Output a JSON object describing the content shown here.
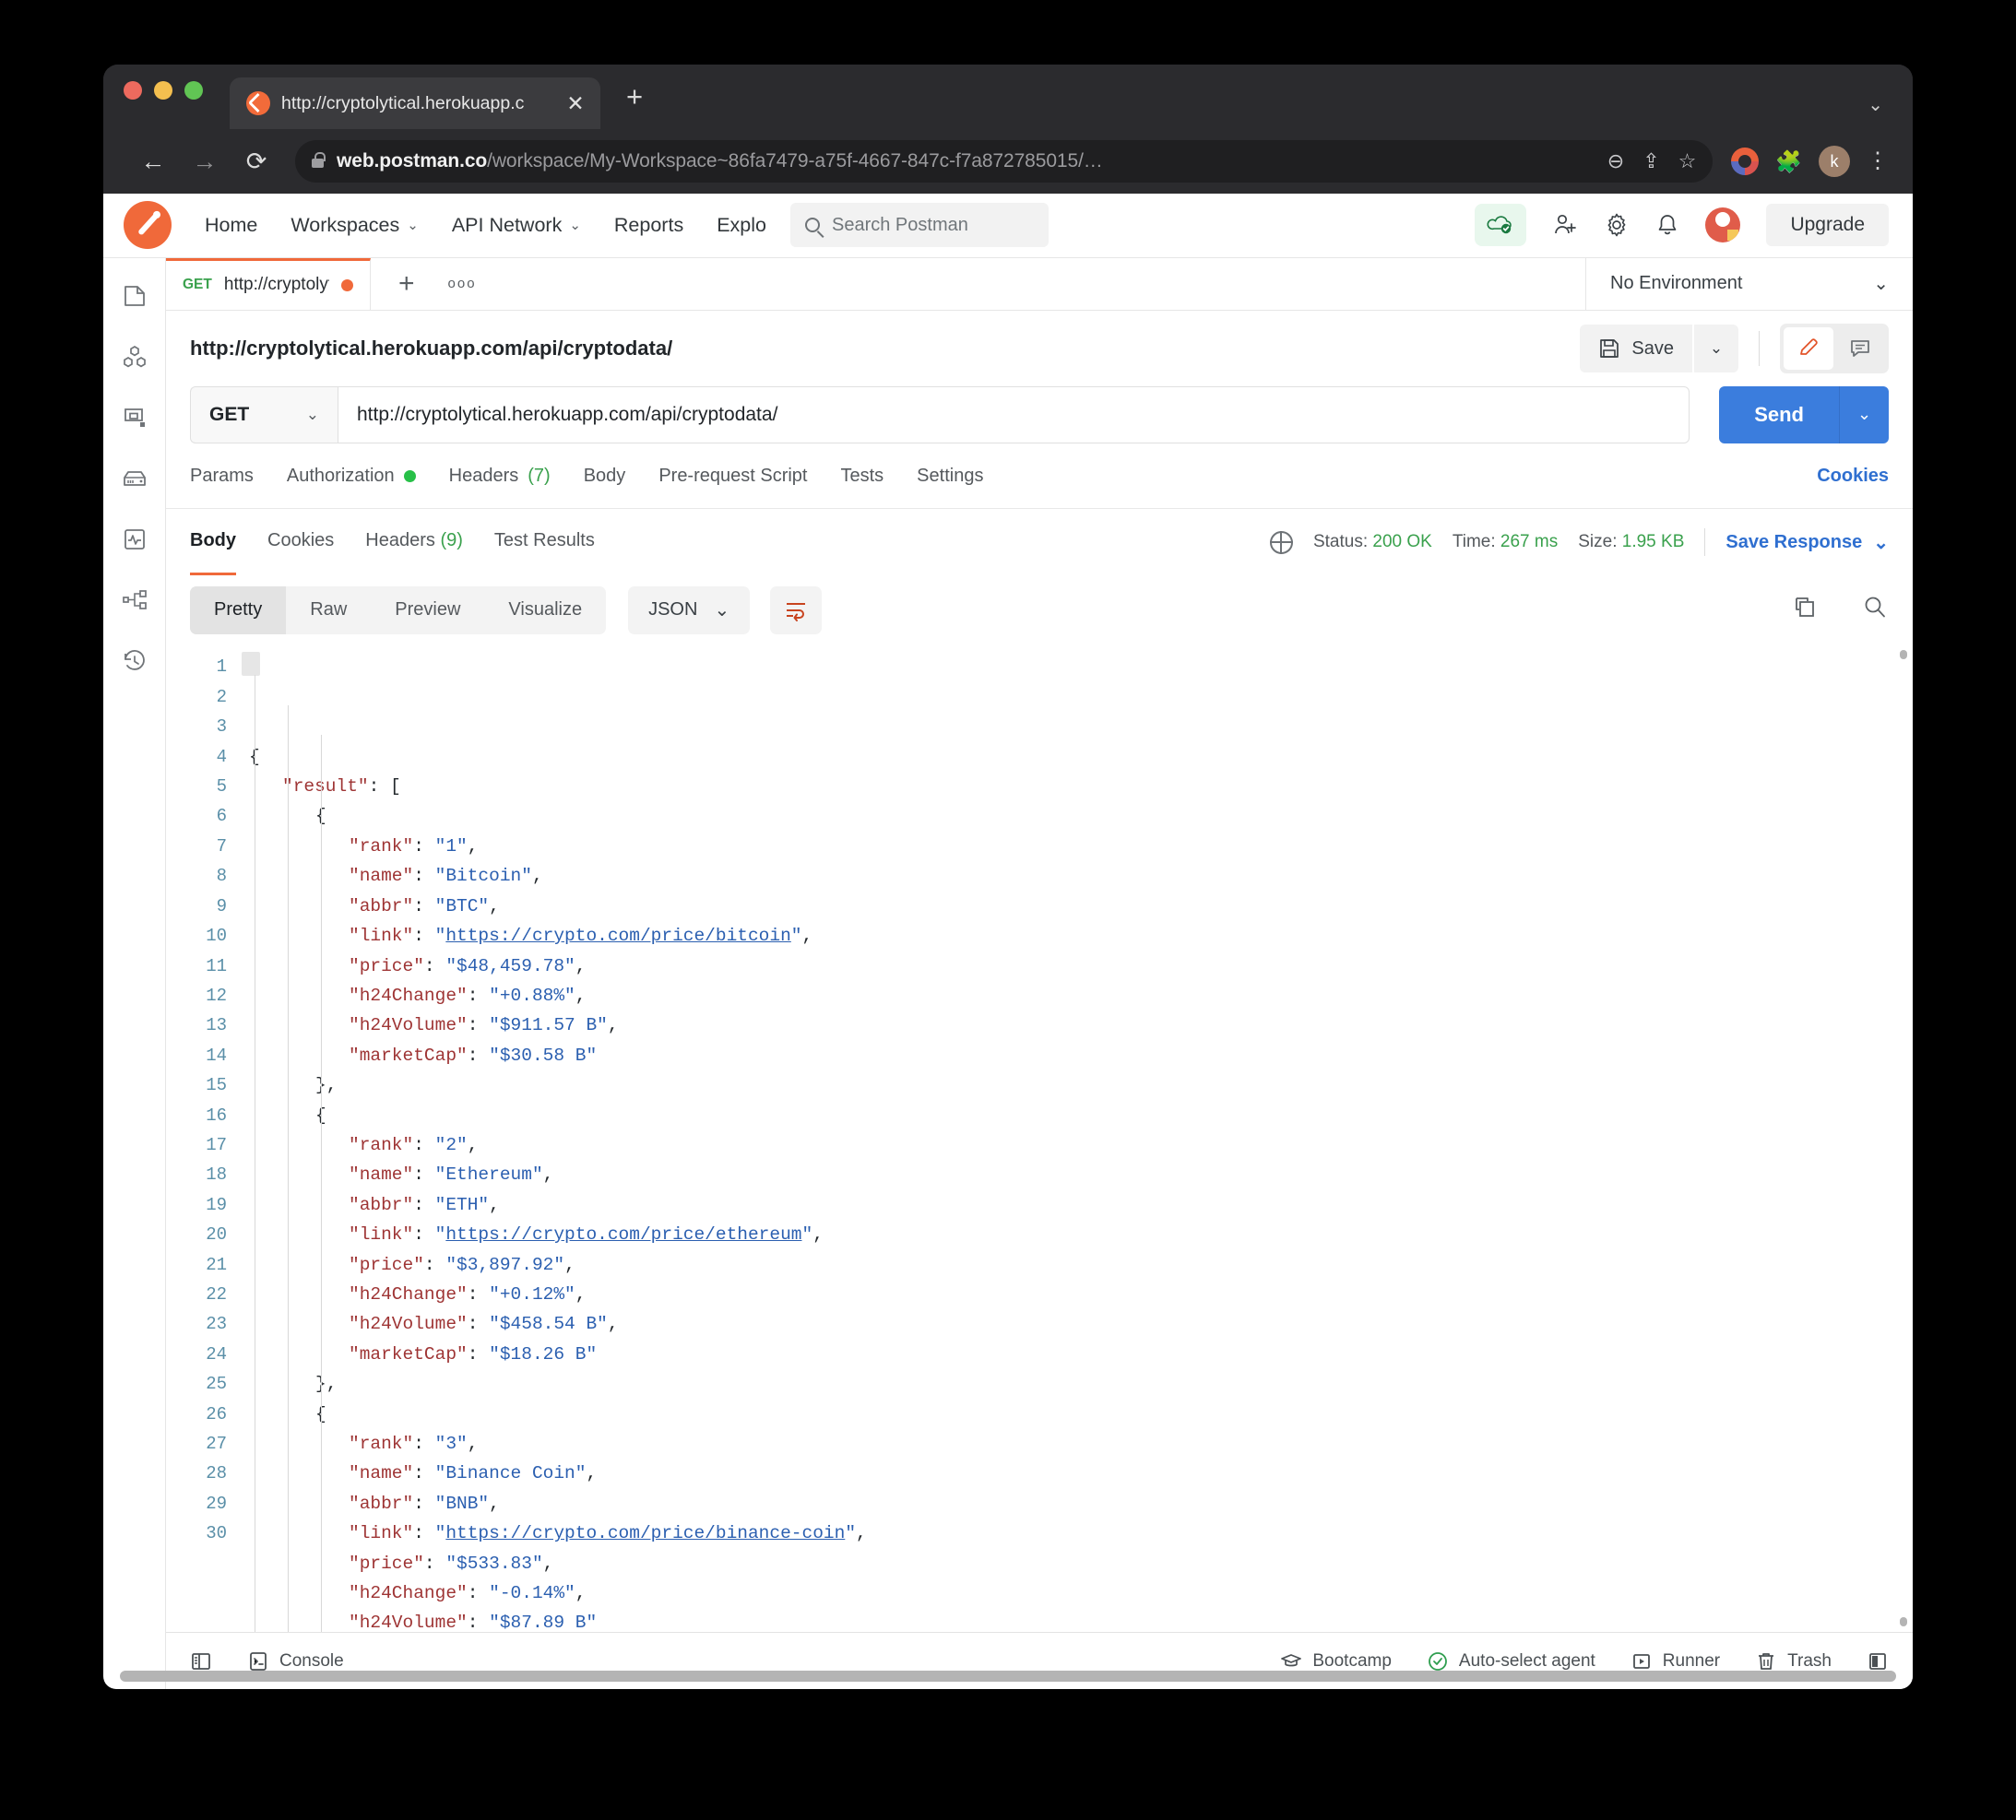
{
  "browser": {
    "tab_title": "http://cryptolytical.herokuapp.c",
    "close_glyph": "✕",
    "newtab_glyph": "+",
    "window_chevron": "⌄",
    "back_glyph": "←",
    "forward_glyph": "→",
    "reload_glyph": "⟳",
    "url_host": "web.postman.co",
    "url_path": "/workspace/My-Workspace~86fa7479-a75f-4667-847c-f7a872785015/…",
    "zoom_glyph": "⊖",
    "share_glyph": "⇪",
    "star_glyph": "☆",
    "puzzle_glyph": "🧩",
    "profile_initial": "k",
    "kebab_glyph": "⋮"
  },
  "topnav": {
    "links": [
      {
        "label": "Home",
        "caret": ""
      },
      {
        "label": "Workspaces",
        "caret": "⌄"
      },
      {
        "label": "API Network",
        "caret": "⌄"
      },
      {
        "label": "Reports",
        "caret": ""
      },
      {
        "label": "Explo",
        "caret": ""
      }
    ],
    "search_placeholder": "Search Postman",
    "upgrade_label": "Upgrade"
  },
  "sidebar": {
    "items": [
      {
        "name": "collections"
      },
      {
        "name": "apis"
      },
      {
        "name": "environments"
      },
      {
        "name": "mock-servers"
      },
      {
        "name": "monitors"
      },
      {
        "name": "flows"
      },
      {
        "name": "history"
      }
    ]
  },
  "request_tabs": {
    "tab": {
      "method": "GET",
      "title": "http://cryptolytical...",
      "unsaved": true
    },
    "add_glyph": "+",
    "more_glyph": "ooo",
    "environment": "No Environment",
    "environment_caret": "⌄"
  },
  "request": {
    "title": "http://cryptolytical.herokuapp.com/api/cryptodata/",
    "save_label": "Save",
    "save_caret": "⌄",
    "method": "GET",
    "method_caret": "⌄",
    "url": "http://cryptolytical.herokuapp.com/api/cryptodata/",
    "send_label": "Send",
    "send_caret": "⌄",
    "tabs": [
      {
        "label": "Params",
        "badge": "",
        "dot": false
      },
      {
        "label": "Authorization",
        "badge": "",
        "dot": true
      },
      {
        "label": "Headers",
        "badge": "(7)",
        "dot": false
      },
      {
        "label": "Body",
        "badge": "",
        "dot": false
      },
      {
        "label": "Pre-request Script",
        "badge": "",
        "dot": false
      },
      {
        "label": "Tests",
        "badge": "",
        "dot": false
      },
      {
        "label": "Settings",
        "badge": "",
        "dot": false
      }
    ],
    "cookies_label": "Cookies"
  },
  "response": {
    "tabs": [
      {
        "label": "Body",
        "badge": "",
        "active": true
      },
      {
        "label": "Cookies",
        "badge": "",
        "active": false
      },
      {
        "label": "Headers",
        "badge": "(9)",
        "active": false
      },
      {
        "label": "Test Results",
        "badge": "",
        "active": false
      }
    ],
    "status_label": "Status:",
    "status_value": "200 OK",
    "time_label": "Time:",
    "time_value": "267 ms",
    "size_label": "Size:",
    "size_value": "1.95 KB",
    "save_response_label": "Save Response",
    "save_response_caret": "⌄",
    "view_modes": [
      {
        "label": "Pretty",
        "active": true
      },
      {
        "label": "Raw",
        "active": false
      },
      {
        "label": "Preview",
        "active": false
      },
      {
        "label": "Visualize",
        "active": false
      }
    ],
    "format": "JSON",
    "format_caret": "⌄"
  },
  "json_body": {
    "lines": [
      {
        "n": 1,
        "indent": 0,
        "html": "<span class=\"p\">{</span>"
      },
      {
        "n": 2,
        "indent": 1,
        "html": "<span class=\"k\">\"result\"</span><span class=\"p\">: [</span>"
      },
      {
        "n": 3,
        "indent": 2,
        "html": "<span class=\"p\">{</span>"
      },
      {
        "n": 4,
        "indent": 3,
        "html": "<span class=\"k\">\"rank\"</span><span class=\"p\">: </span><span class=\"s\">\"1\"</span><span class=\"p\">,</span>"
      },
      {
        "n": 5,
        "indent": 3,
        "html": "<span class=\"k\">\"name\"</span><span class=\"p\">: </span><span class=\"s\">\"Bitcoin\"</span><span class=\"p\">,</span>"
      },
      {
        "n": 6,
        "indent": 3,
        "html": "<span class=\"k\">\"abbr\"</span><span class=\"p\">: </span><span class=\"s\">\"BTC\"</span><span class=\"p\">,</span>"
      },
      {
        "n": 7,
        "indent": 3,
        "html": "<span class=\"k\">\"link\"</span><span class=\"p\">: </span><span class=\"s\">\"</span><span class=\"lnk\">https://crypto.com/price/bitcoin</span><span class=\"s\">\"</span><span class=\"p\">,</span>"
      },
      {
        "n": 8,
        "indent": 3,
        "html": "<span class=\"k\">\"price\"</span><span class=\"p\">: </span><span class=\"s\">\"$48,459.78\"</span><span class=\"p\">,</span>"
      },
      {
        "n": 9,
        "indent": 3,
        "html": "<span class=\"k\">\"h24Change\"</span><span class=\"p\">: </span><span class=\"s\">\"+0.88%\"</span><span class=\"p\">,</span>"
      },
      {
        "n": 10,
        "indent": 3,
        "html": "<span class=\"k\">\"h24Volume\"</span><span class=\"p\">: </span><span class=\"s\">\"$911.57 B\"</span><span class=\"p\">,</span>"
      },
      {
        "n": 11,
        "indent": 3,
        "html": "<span class=\"k\">\"marketCap\"</span><span class=\"p\">: </span><span class=\"s\">\"$30.58 B\"</span>"
      },
      {
        "n": 12,
        "indent": 2,
        "html": "<span class=\"p\">},</span>"
      },
      {
        "n": 13,
        "indent": 2,
        "html": "<span class=\"p\">{</span>"
      },
      {
        "n": 14,
        "indent": 3,
        "html": "<span class=\"k\">\"rank\"</span><span class=\"p\">: </span><span class=\"s\">\"2\"</span><span class=\"p\">,</span>"
      },
      {
        "n": 15,
        "indent": 3,
        "html": "<span class=\"k\">\"name\"</span><span class=\"p\">: </span><span class=\"s\">\"Ethereum\"</span><span class=\"p\">,</span>"
      },
      {
        "n": 16,
        "indent": 3,
        "html": "<span class=\"k\">\"abbr\"</span><span class=\"p\">: </span><span class=\"s\">\"ETH\"</span><span class=\"p\">,</span>"
      },
      {
        "n": 17,
        "indent": 3,
        "html": "<span class=\"k\">\"link\"</span><span class=\"p\">: </span><span class=\"s\">\"</span><span class=\"lnk\">https://crypto.com/price/ethereum</span><span class=\"s\">\"</span><span class=\"p\">,</span>"
      },
      {
        "n": 18,
        "indent": 3,
        "html": "<span class=\"k\">\"price\"</span><span class=\"p\">: </span><span class=\"s\">\"$3,897.92\"</span><span class=\"p\">,</span>"
      },
      {
        "n": 19,
        "indent": 3,
        "html": "<span class=\"k\">\"h24Change\"</span><span class=\"p\">: </span><span class=\"s\">\"+0.12%\"</span><span class=\"p\">,</span>"
      },
      {
        "n": 20,
        "indent": 3,
        "html": "<span class=\"k\">\"h24Volume\"</span><span class=\"p\">: </span><span class=\"s\">\"$458.54 B\"</span><span class=\"p\">,</span>"
      },
      {
        "n": 21,
        "indent": 3,
        "html": "<span class=\"k\">\"marketCap\"</span><span class=\"p\">: </span><span class=\"s\">\"$18.26 B\"</span>"
      },
      {
        "n": 22,
        "indent": 2,
        "html": "<span class=\"p\">},</span>"
      },
      {
        "n": 23,
        "indent": 2,
        "html": "<span class=\"p\">{</span>"
      },
      {
        "n": 24,
        "indent": 3,
        "html": "<span class=\"k\">\"rank\"</span><span class=\"p\">: </span><span class=\"s\">\"3\"</span><span class=\"p\">,</span>"
      },
      {
        "n": 25,
        "indent": 3,
        "html": "<span class=\"k\">\"name\"</span><span class=\"p\">: </span><span class=\"s\">\"Binance Coin\"</span><span class=\"p\">,</span>"
      },
      {
        "n": 26,
        "indent": 3,
        "html": "<span class=\"k\">\"abbr\"</span><span class=\"p\">: </span><span class=\"s\">\"BNB\"</span><span class=\"p\">,</span>"
      },
      {
        "n": 27,
        "indent": 3,
        "html": "<span class=\"k\">\"link\"</span><span class=\"p\">: </span><span class=\"s\">\"</span><span class=\"lnk\">https://crypto.com/price/binance-coin</span><span class=\"s\">\"</span><span class=\"p\">,</span>"
      },
      {
        "n": 28,
        "indent": 3,
        "html": "<span class=\"k\">\"price\"</span><span class=\"p\">: </span><span class=\"s\">\"$533.83\"</span><span class=\"p\">,</span>"
      },
      {
        "n": 29,
        "indent": 3,
        "html": "<span class=\"k\">\"h24Change\"</span><span class=\"p\">: </span><span class=\"s\">\"-0.14%\"</span><span class=\"p\">,</span>"
      },
      {
        "n": 30,
        "indent": 3,
        "html": "<span class=\"k\">\"h24Volume\"</span><span class=\"p\">: </span><span class=\"s\">\"$87.89 B\"</span>"
      }
    ]
  },
  "statusbar": {
    "left": [
      {
        "label": "",
        "icon": "sidebar-toggle"
      },
      {
        "label": "Console",
        "icon": "console"
      }
    ],
    "right": [
      {
        "label": "Bootcamp",
        "icon": "bootcamp"
      },
      {
        "label": "Auto-select agent",
        "icon": "check-circle"
      },
      {
        "label": "Runner",
        "icon": "play-box"
      },
      {
        "label": "Trash",
        "icon": "trash"
      },
      {
        "label": "",
        "icon": "layout-panel"
      }
    ]
  }
}
